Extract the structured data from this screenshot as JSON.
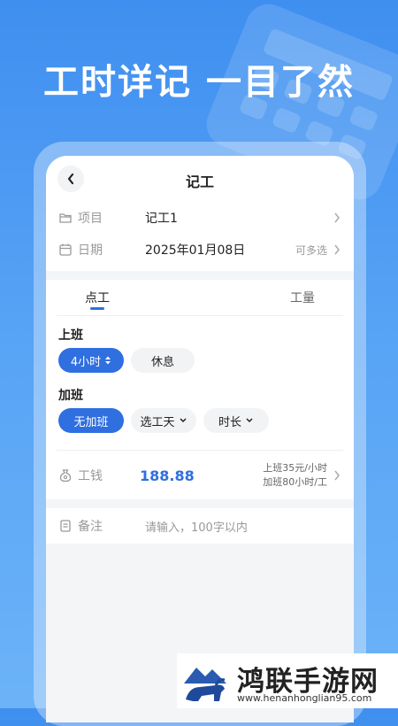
{
  "headline": "工时详记 一目了然",
  "header": {
    "title": "记工"
  },
  "project": {
    "label": "项目",
    "value": "记工1"
  },
  "date": {
    "label": "日期",
    "value": "2025年01月08日",
    "hint": "可多选"
  },
  "tabs": [
    {
      "label": "点工",
      "active": true
    },
    {
      "label": "工量",
      "active": false
    }
  ],
  "shift": {
    "label": "上班",
    "selected": "4小时",
    "other": "休息"
  },
  "overtime": {
    "label": "加班",
    "selected": "无加班",
    "option1": "选工天",
    "option2": "时长"
  },
  "wage": {
    "label": "工钱",
    "value": "188.88",
    "rate_line1": "上班35元/小时",
    "rate_line2": "加班80小时/工"
  },
  "note": {
    "label": "备注",
    "placeholder": "请输入，100字以内"
  },
  "watermark": {
    "name": "鸿联手游网",
    "url": "www.henanhonglian95.com"
  },
  "colors": {
    "accent": "#2f6fe0",
    "bg_top": "#3f8ff0"
  }
}
